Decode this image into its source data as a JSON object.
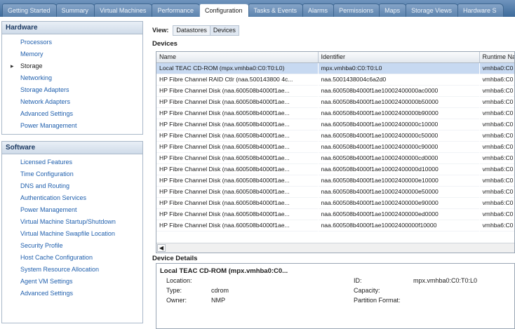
{
  "tabs": [
    {
      "label": "Getting Started"
    },
    {
      "label": "Summary"
    },
    {
      "label": "Virtual Machines"
    },
    {
      "label": "Performance"
    },
    {
      "label": "Configuration",
      "active": true
    },
    {
      "label": "Tasks & Events"
    },
    {
      "label": "Alarms"
    },
    {
      "label": "Permissions"
    },
    {
      "label": "Maps"
    },
    {
      "label": "Storage Views"
    },
    {
      "label": "Hardware S"
    }
  ],
  "hardware": {
    "title": "Hardware",
    "items": [
      "Processors",
      "Memory",
      "Storage",
      "Networking",
      "Storage Adapters",
      "Network Adapters",
      "Advanced Settings",
      "Power Management"
    ],
    "current": "Storage"
  },
  "software": {
    "title": "Software",
    "items": [
      "Licensed Features",
      "Time Configuration",
      "DNS and Routing",
      "Authentication Services",
      "Power Management",
      "Virtual Machine Startup/Shutdown",
      "Virtual Machine Swapfile Location",
      "Security Profile",
      "Host Cache Configuration",
      "System Resource Allocation",
      "Agent VM Settings",
      "Advanced Settings"
    ]
  },
  "view": {
    "label": "View:",
    "datastores": "Datastores",
    "devices": "Devices"
  },
  "devices": {
    "title": "Devices",
    "columns": [
      "Name",
      "Identifier",
      "Runtime Na"
    ],
    "rows": [
      [
        "Local TEAC CD-ROM (mpx.vmhba0:C0:T0:L0)",
        "mpx.vmhba0:C0:T0:L0",
        "vmhba0:C0"
      ],
      [
        "HP Fibre Channel RAID Ctlr (naa.500143800 4c...",
        "naa.5001438004c6a2d0",
        "vmhba6:C0"
      ],
      [
        "HP Fibre Channel Disk (naa.600508b4000f1ae...",
        "naa.600508b4000f1ae10002400000ac0000",
        "vmhba6:C0"
      ],
      [
        "HP Fibre Channel Disk (naa.600508b4000f1ae...",
        "naa.600508b4000f1ae10002400000b50000",
        "vmhba6:C0"
      ],
      [
        "HP Fibre Channel Disk (naa.600508b4000f1ae...",
        "naa.600508b4000f1ae10002400000b90000",
        "vmhba6:C0"
      ],
      [
        "HP Fibre Channel Disk (naa.600508b4000f1ae...",
        "naa.600508b4000f1ae10002400000c10000",
        "vmhba6:C0"
      ],
      [
        "HP Fibre Channel Disk (naa.600508b4000f1ae...",
        "naa.600508b4000f1ae10002400000c50000",
        "vmhba6:C0"
      ],
      [
        "HP Fibre Channel Disk (naa.600508b4000f1ae...",
        "naa.600508b4000f1ae10002400000c90000",
        "vmhba6:C0"
      ],
      [
        "HP Fibre Channel Disk (naa.600508b4000f1ae...",
        "naa.600508b4000f1ae10002400000cd0000",
        "vmhba6:C0"
      ],
      [
        "HP Fibre Channel Disk (naa.600508b4000f1ae...",
        "naa.600508b4000f1ae10002400000d10000",
        "vmhba6:C0"
      ],
      [
        "HP Fibre Channel Disk (naa.600508b4000f1ae...",
        "naa.600508b4000f1ae10002400000e10000",
        "vmhba6:C0"
      ],
      [
        "HP Fibre Channel Disk (naa.600508b4000f1ae...",
        "naa.600508b4000f1ae10002400000e50000",
        "vmhba6:C0"
      ],
      [
        "HP Fibre Channel Disk (naa.600508b4000f1ae...",
        "naa.600508b4000f1ae10002400000e90000",
        "vmhba6:C0"
      ],
      [
        "HP Fibre Channel Disk (naa.600508b4000f1ae...",
        "naa.600508b4000f1ae10002400000ed0000",
        "vmhba6:C0"
      ],
      [
        "HP Fibre Channel Disk (naa.600508b4000f1ae...",
        "naa.600508b4000f1ae10002400000f10000",
        "vmhba6:C0"
      ]
    ]
  },
  "details": {
    "title": "Device Details",
    "name": "Local TEAC CD-ROM (mpx.vmhba0:C0...",
    "location_label": "Location:",
    "location_value": "",
    "type_label": "Type:",
    "type_value": "cdrom",
    "owner_label": "Owner:",
    "owner_value": "NMP",
    "id_label": "ID:",
    "id_value": "mpx.vmhba0:C0:T0:L0",
    "capacity_label": "Capacity:",
    "capacity_value": "",
    "partition_label": "Partition Format:",
    "partition_value": ""
  }
}
